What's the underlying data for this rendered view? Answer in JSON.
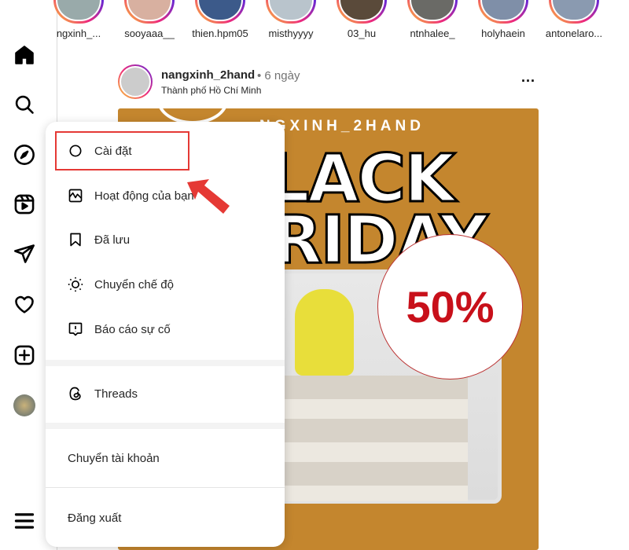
{
  "stories": [
    "ngxinh_...",
    "sooyaaa__",
    "thien.hpm05",
    "misthyyyy",
    "03_hu",
    "ntnhalee_",
    "holyhaein",
    "antonelaro..."
  ],
  "post": {
    "username": "nangxinh_2hand",
    "time": "• 6 ngày",
    "location": "Thành phố Hồ Chí Minh",
    "more": "...",
    "image": {
      "brand": "NGXINH_2HAND",
      "line1": "LACK",
      "line2": "RIDAY",
      "discount": "50%",
      "bg_color": "#c4862e"
    }
  },
  "sidebar": {
    "icons": [
      "home-icon",
      "search-icon",
      "explore-icon",
      "reels-icon",
      "messages-icon",
      "notifications-icon",
      "create-icon",
      "profile-avatar",
      "menu-icon"
    ]
  },
  "menu": {
    "items": [
      {
        "label": "Cài đặt",
        "icon": "settings-icon"
      },
      {
        "label": "Hoạt động của bạn",
        "icon": "activity-icon"
      },
      {
        "label": "Đã lưu",
        "icon": "saved-icon"
      },
      {
        "label": "Chuyển chế độ",
        "icon": "appearance-icon"
      },
      {
        "label": "Báo cáo sự cố",
        "icon": "report-icon"
      },
      {
        "label": "Threads",
        "icon": "threads-icon"
      },
      {
        "label": "Chuyển tài khoản"
      },
      {
        "label": "Đăng xuất"
      }
    ]
  },
  "annotation": {
    "highlight_color": "#e53935"
  }
}
